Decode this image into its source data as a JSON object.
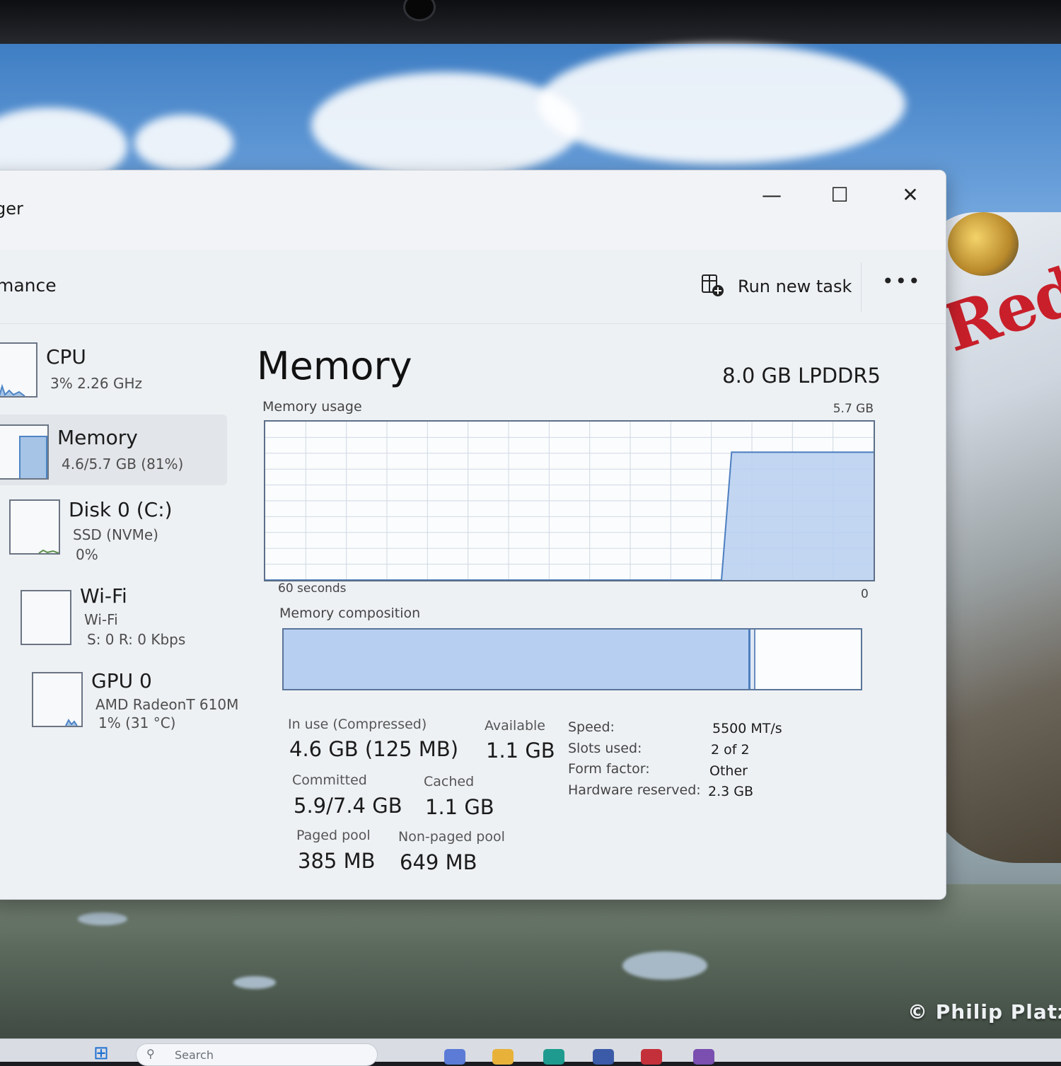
{
  "wallpaper": {
    "credit": "© Philip Platz",
    "brand_text": "Red"
  },
  "window": {
    "title": "ger",
    "controls": {
      "minimize": "—",
      "maximize": "☐",
      "close": "✕"
    }
  },
  "commandbar": {
    "page_title": "mance",
    "run_new_task": "Run new task",
    "more": "•••"
  },
  "sidebar": {
    "items": [
      {
        "name": "CPU",
        "line1": "3% 2.26 GHz",
        "line2": ""
      },
      {
        "name": "Memory",
        "line1": "4.6/5.7 GB (81%)",
        "line2": ""
      },
      {
        "name": "Disk 0 (C:)",
        "line1": "SSD (NVMe)",
        "line2": "0%"
      },
      {
        "name": "Wi-Fi",
        "line1": "Wi-Fi",
        "line2": "S: 0 R: 0 Kbps"
      },
      {
        "name": "GPU 0",
        "line1": "AMD RadeonT 610M",
        "line2": "1% (31 °C)"
      }
    ]
  },
  "memory": {
    "title": "Memory",
    "spec": "8.0 GB LPDDR5",
    "usage_label": "Memory usage",
    "usage_max": "5.7 GB",
    "time_left": "60 seconds",
    "time_right": "0",
    "composition_label": "Memory composition",
    "in_use_fraction": 0.805,
    "modified_fraction": 0.006,
    "stats": {
      "in_use_label": "In use (Compressed)",
      "in_use_value": "4.6 GB (125 MB)",
      "available_label": "Available",
      "available_value": "1.1 GB",
      "committed_label": "Committed",
      "committed_value": "5.9/7.4 GB",
      "cached_label": "Cached",
      "cached_value": "1.1 GB",
      "paged_label": "Paged pool",
      "paged_value": "385 MB",
      "nonpaged_label": "Non-paged pool",
      "nonpaged_value": "649 MB"
    },
    "hardware": {
      "speed_label": "Speed:",
      "speed_value": "5500 MT/s",
      "slots_label": "Slots used:",
      "slots_value": "2 of 2",
      "form_label": "Form factor:",
      "form_value": "Other",
      "reserved_label": "Hardware reserved:",
      "reserved_value": "2.3 GB"
    },
    "history": {
      "seconds": [
        60,
        55,
        50,
        45,
        40,
        35,
        30,
        25,
        20,
        15,
        14,
        13,
        10,
        5,
        0
      ],
      "used_gb": [
        0,
        0,
        0,
        0,
        0,
        0,
        0,
        0,
        0,
        0,
        4.6,
        4.6,
        4.6,
        4.6,
        4.6
      ],
      "max_gb": 5.7
    }
  },
  "taskbar": {
    "search_placeholder": "Search"
  },
  "colors": {
    "graph_fill": "#b7cff0",
    "graph_line": "#4d7fc0",
    "grid": "#cfd9e4"
  }
}
